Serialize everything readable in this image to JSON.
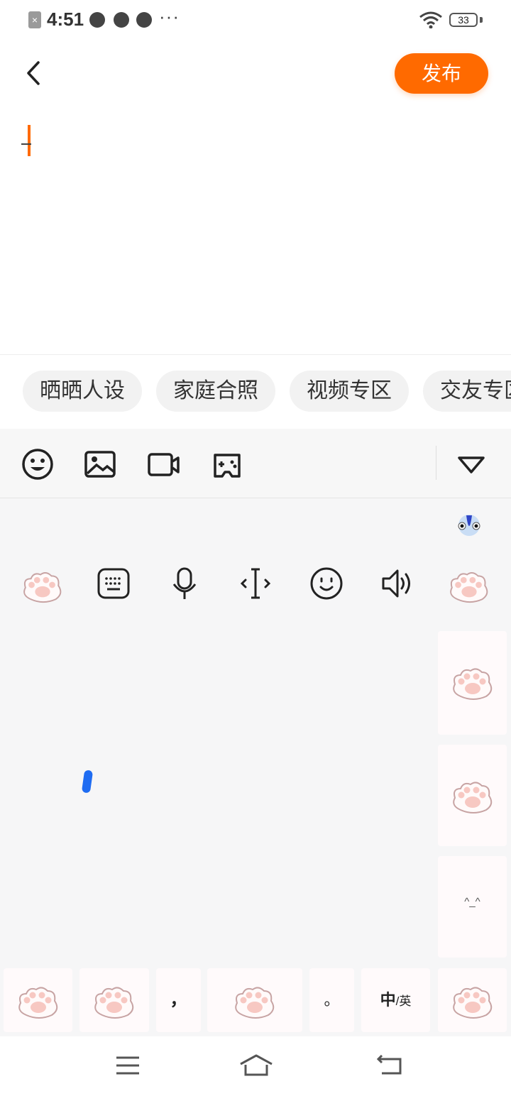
{
  "status_bar": {
    "time": "4:51",
    "battery": "33",
    "more": "···",
    "icons": [
      "sim-off-icon",
      "voice-icon",
      "speed-icon",
      "play-icon",
      "wifi-icon",
      "battery-icon"
    ]
  },
  "header": {
    "back_icon": "chevron-left-icon",
    "publish_label": "发布"
  },
  "tags": [
    "晒晒人设",
    "家庭合照",
    "视频专区",
    "交友专区"
  ],
  "toolbar": {
    "icons": [
      "emoji-icon",
      "image-icon",
      "video-icon",
      "game-icon",
      "collapse-triangle-icon"
    ]
  },
  "keyboard": {
    "tools": [
      "paw-icon",
      "keyboard-icon",
      "microphone-icon",
      "cursor-icon",
      "smile-icon",
      "speaker-icon",
      "paw-icon"
    ],
    "side_keys": [
      "paw",
      "paw",
      "^_^"
    ],
    "bottom_keys": [
      "paw",
      "paw",
      "，",
      "paw",
      "。",
      "中/英",
      "paw"
    ],
    "lang_main": "中",
    "lang_sub": "/英",
    "comma": "，",
    "period": "。",
    "emoticon": "^_^",
    "accent_color": "#ff6a00"
  },
  "nav_bar": {
    "icons": [
      "menu-icon",
      "home-icon",
      "back-icon"
    ]
  }
}
